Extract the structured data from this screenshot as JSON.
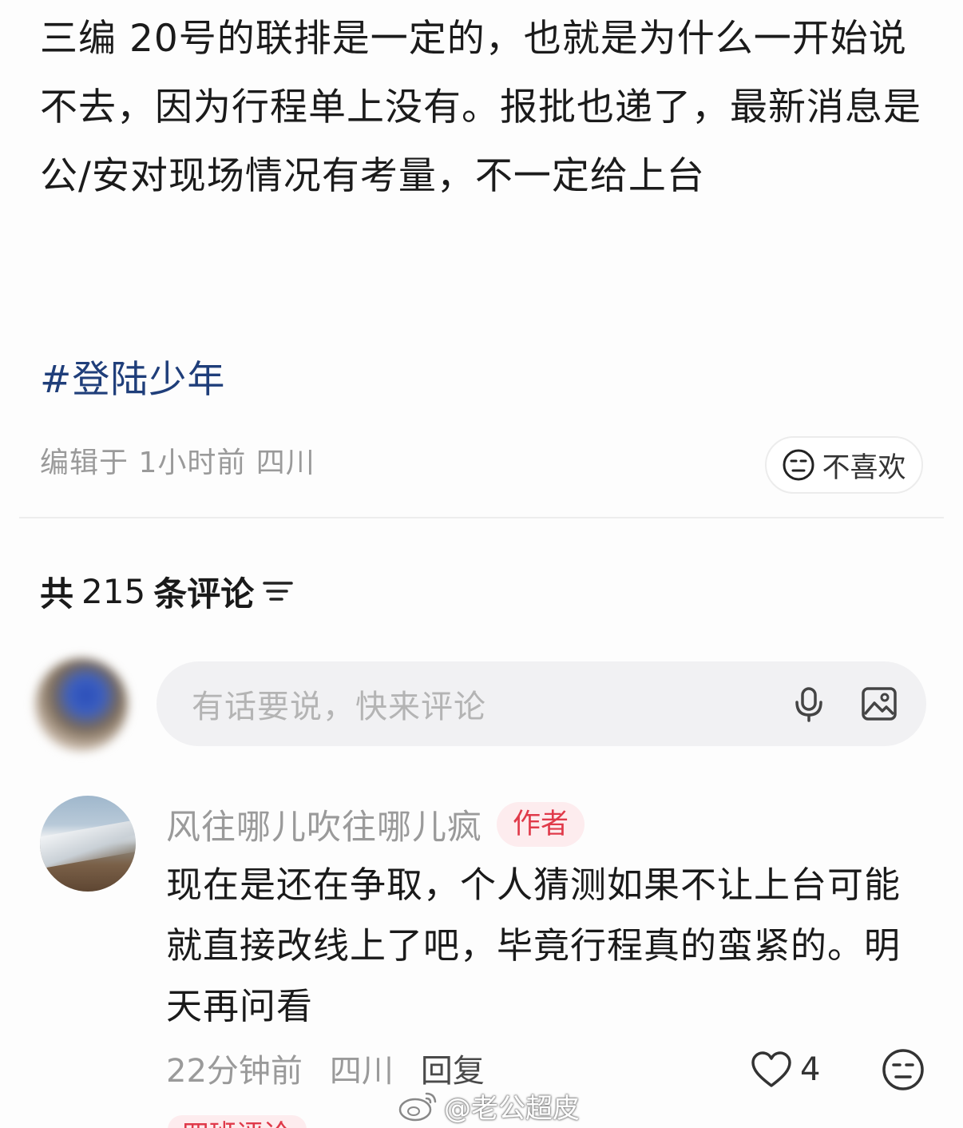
{
  "post": {
    "body": "三编  20号的联排是一定的，也就是为什么一开始说不去，因为行程单上没有。报批也递了，最新消息是公/安对现场情况有考量，不一定给上台",
    "hashtag": "#登陆少年",
    "meta": "编辑于 1小时前 四川",
    "dislike_label": "不喜欢"
  },
  "comments": {
    "header_prefix": "共",
    "count": "215",
    "header_suffix": "条评论",
    "input_placeholder": "有话要说，快来评论",
    "items": [
      {
        "author": "风往哪儿吹往哪儿疯",
        "badge": "作者",
        "text": "现在是还在争取，个人猜测如果不让上台可能就直接改线上了吧，毕竟行程真的蛮紧的。明天再问看",
        "time": "22分钟前",
        "location": "四川",
        "reply_label": "回复",
        "likes": "4"
      }
    ],
    "next_badge_partial": "四班评论"
  },
  "watermark": {
    "text": "@老公超皮"
  },
  "colors": {
    "hashtag": "#1f3e7a",
    "author_badge_bg": "#fdecee",
    "author_badge_text": "#e03a4a",
    "meta_gray": "#9a9a9a",
    "input_bg": "#f1f1f3"
  },
  "icons": {
    "dislike": "neutral-face-icon",
    "sort": "sort-lines-icon",
    "voice": "microphone-icon",
    "image": "image-icon",
    "like": "heart-outline-icon",
    "comment_dislike": "neutral-face-icon",
    "watermark": "weibo-logo-icon"
  }
}
